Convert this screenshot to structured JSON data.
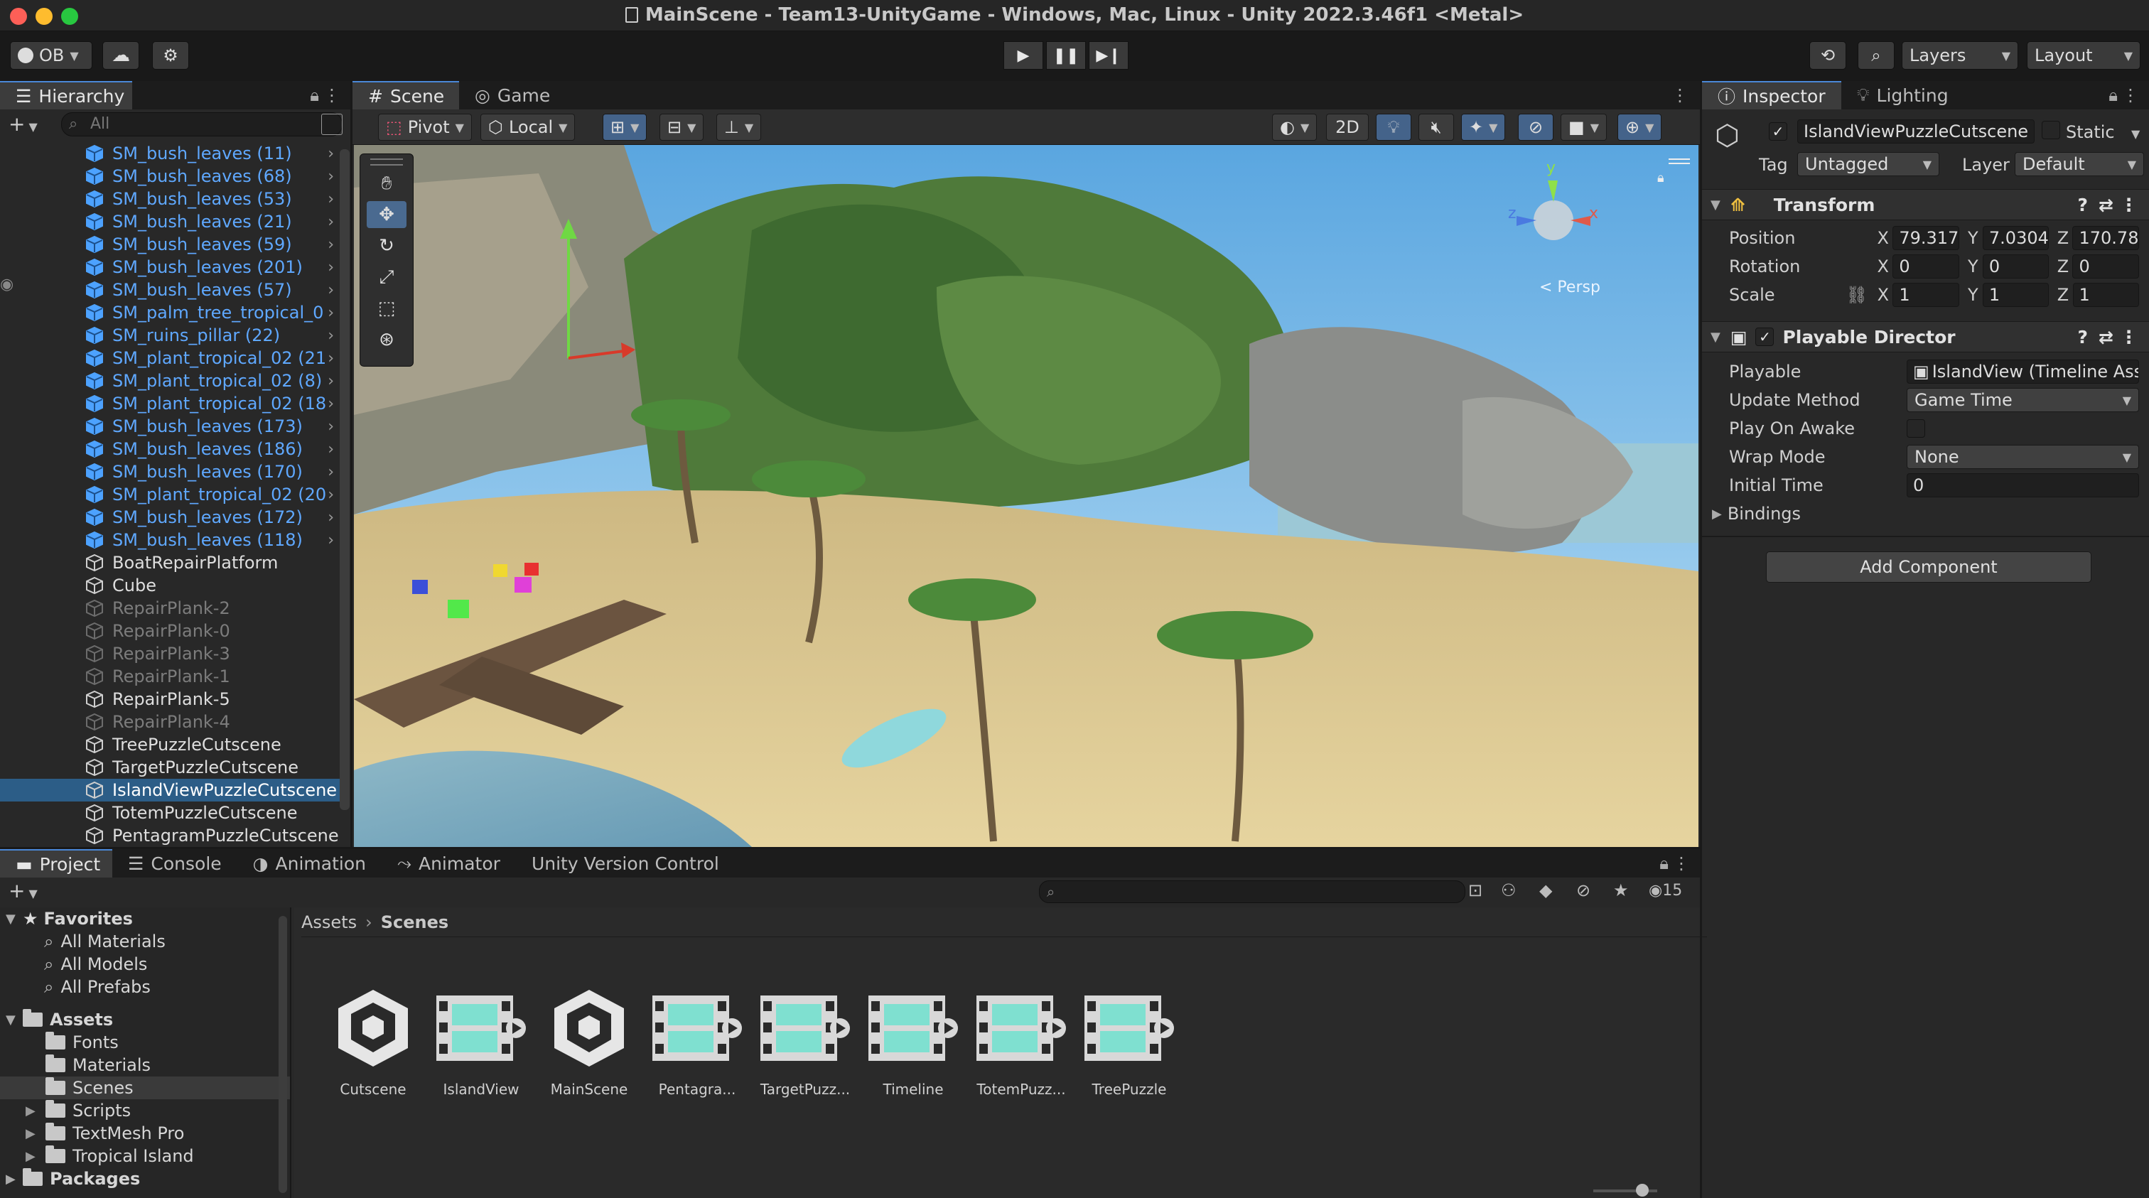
{
  "window": {
    "title": "MainScene - Team13-UnityGame - Windows, Mac, Linux - Unity 2022.3.46f1 <Metal>"
  },
  "toolbar": {
    "account": "OB",
    "layers": "Layers",
    "layout": "Layout"
  },
  "hierarchy": {
    "tab": "Hierarchy",
    "search_placeholder": "All",
    "items": [
      {
        "label": "SM_bush_leaves (11)",
        "kind": "prefab"
      },
      {
        "label": "SM_bush_leaves (68)",
        "kind": "prefab"
      },
      {
        "label": "SM_bush_leaves (53)",
        "kind": "prefab"
      },
      {
        "label": "SM_bush_leaves (21)",
        "kind": "prefab"
      },
      {
        "label": "SM_bush_leaves (59)",
        "kind": "prefab"
      },
      {
        "label": "SM_bush_leaves (201)",
        "kind": "prefab"
      },
      {
        "label": "SM_bush_leaves (57)",
        "kind": "prefab"
      },
      {
        "label": "SM_palm_tree_tropical_0",
        "kind": "prefab"
      },
      {
        "label": "SM_ruins_pillar (22)",
        "kind": "prefab"
      },
      {
        "label": "SM_plant_tropical_02 (21",
        "kind": "prefab"
      },
      {
        "label": "SM_plant_tropical_02 (8)",
        "kind": "prefab"
      },
      {
        "label": "SM_plant_tropical_02 (18",
        "kind": "prefab"
      },
      {
        "label": "SM_bush_leaves (173)",
        "kind": "prefab"
      },
      {
        "label": "SM_bush_leaves (186)",
        "kind": "prefab"
      },
      {
        "label": "SM_bush_leaves (170)",
        "kind": "prefab"
      },
      {
        "label": "SM_plant_tropical_02 (20",
        "kind": "prefab"
      },
      {
        "label": "SM_bush_leaves (172)",
        "kind": "prefab"
      },
      {
        "label": "SM_bush_leaves (118)",
        "kind": "prefab"
      },
      {
        "label": "BoatRepairPlatform",
        "kind": "normal"
      },
      {
        "label": "Cube",
        "kind": "normal"
      },
      {
        "label": "RepairPlank-2",
        "kind": "dim"
      },
      {
        "label": "RepairPlank-0",
        "kind": "dim"
      },
      {
        "label": "RepairPlank-3",
        "kind": "dim"
      },
      {
        "label": "RepairPlank-1",
        "kind": "dim"
      },
      {
        "label": "RepairPlank-5",
        "kind": "normal"
      },
      {
        "label": "RepairPlank-4",
        "kind": "dim"
      },
      {
        "label": "TreePuzzleCutscene",
        "kind": "normal"
      },
      {
        "label": "TargetPuzzleCutscene",
        "kind": "normal"
      },
      {
        "label": "IslandViewPuzzleCutscene",
        "kind": "selected"
      },
      {
        "label": "TotemPuzzleCutscene",
        "kind": "normal"
      },
      {
        "label": "PentagramPuzzleCutscene",
        "kind": "normal"
      }
    ]
  },
  "scene": {
    "tabs": [
      "Scene",
      "Game"
    ],
    "pivot": "Pivot",
    "local": "Local",
    "mode_2d": "2D",
    "persp": "< Persp",
    "gizmo_y": "y",
    "gizmo_x": "x",
    "gizmo_z": "z"
  },
  "inspector": {
    "tabs": [
      "Inspector",
      "Lighting"
    ],
    "object_name": "IslandViewPuzzleCutscene",
    "static_label": "Static",
    "tag_label": "Tag",
    "tag_value": "Untagged",
    "layer_label": "Layer",
    "layer_value": "Default",
    "transform": {
      "title": "Transform",
      "position_label": "Position",
      "rotation_label": "Rotation",
      "scale_label": "Scale",
      "position": [
        "79.317",
        "7.0304",
        "170.78"
      ],
      "rotation": [
        "0",
        "0",
        "0"
      ],
      "scale": [
        "1",
        "1",
        "1"
      ],
      "axes": [
        "X",
        "Y",
        "Z"
      ]
    },
    "director": {
      "title": "Playable Director",
      "playable_label": "Playable",
      "playable_value": "IslandView (Timeline Ass",
      "update_method_label": "Update Method",
      "update_method_value": "Game Time",
      "play_on_awake_label": "Play On Awake",
      "wrap_mode_label": "Wrap Mode",
      "wrap_mode_value": "None",
      "initial_time_label": "Initial Time",
      "initial_time_value": "0",
      "bindings_label": "Bindings"
    },
    "add_component": "Add Component"
  },
  "project": {
    "tabs": [
      "Project",
      "Console",
      "Animation",
      "Animator",
      "Unity Version Control"
    ],
    "hidden_count": "15",
    "favorites": {
      "label": "Favorites",
      "items": [
        "All Materials",
        "All Models",
        "All Prefabs"
      ]
    },
    "assets": {
      "label": "Assets",
      "items": [
        "Fonts",
        "Materials",
        "Scenes",
        "Scripts",
        "TextMesh Pro",
        "Tropical Island"
      ]
    },
    "packages": "Packages",
    "breadcrumb": [
      "Assets",
      "Scenes"
    ],
    "files": [
      {
        "name": "Cutscene",
        "type": "scene"
      },
      {
        "name": "IslandView",
        "type": "timeline"
      },
      {
        "name": "MainScene",
        "type": "scene"
      },
      {
        "name": "Pentagra...",
        "type": "timeline"
      },
      {
        "name": "TargetPuzz...",
        "type": "timeline"
      },
      {
        "name": "Timeline",
        "type": "timeline"
      },
      {
        "name": "TotemPuzz...",
        "type": "timeline"
      },
      {
        "name": "TreePuzzle",
        "type": "timeline"
      }
    ]
  },
  "colors": {
    "accent": "#2c5d87",
    "prefab_text": "#5fa8ff",
    "sky": "#8ec9ee",
    "sand": "#d9c48d",
    "timeline_teal": "#7fe0d0"
  }
}
